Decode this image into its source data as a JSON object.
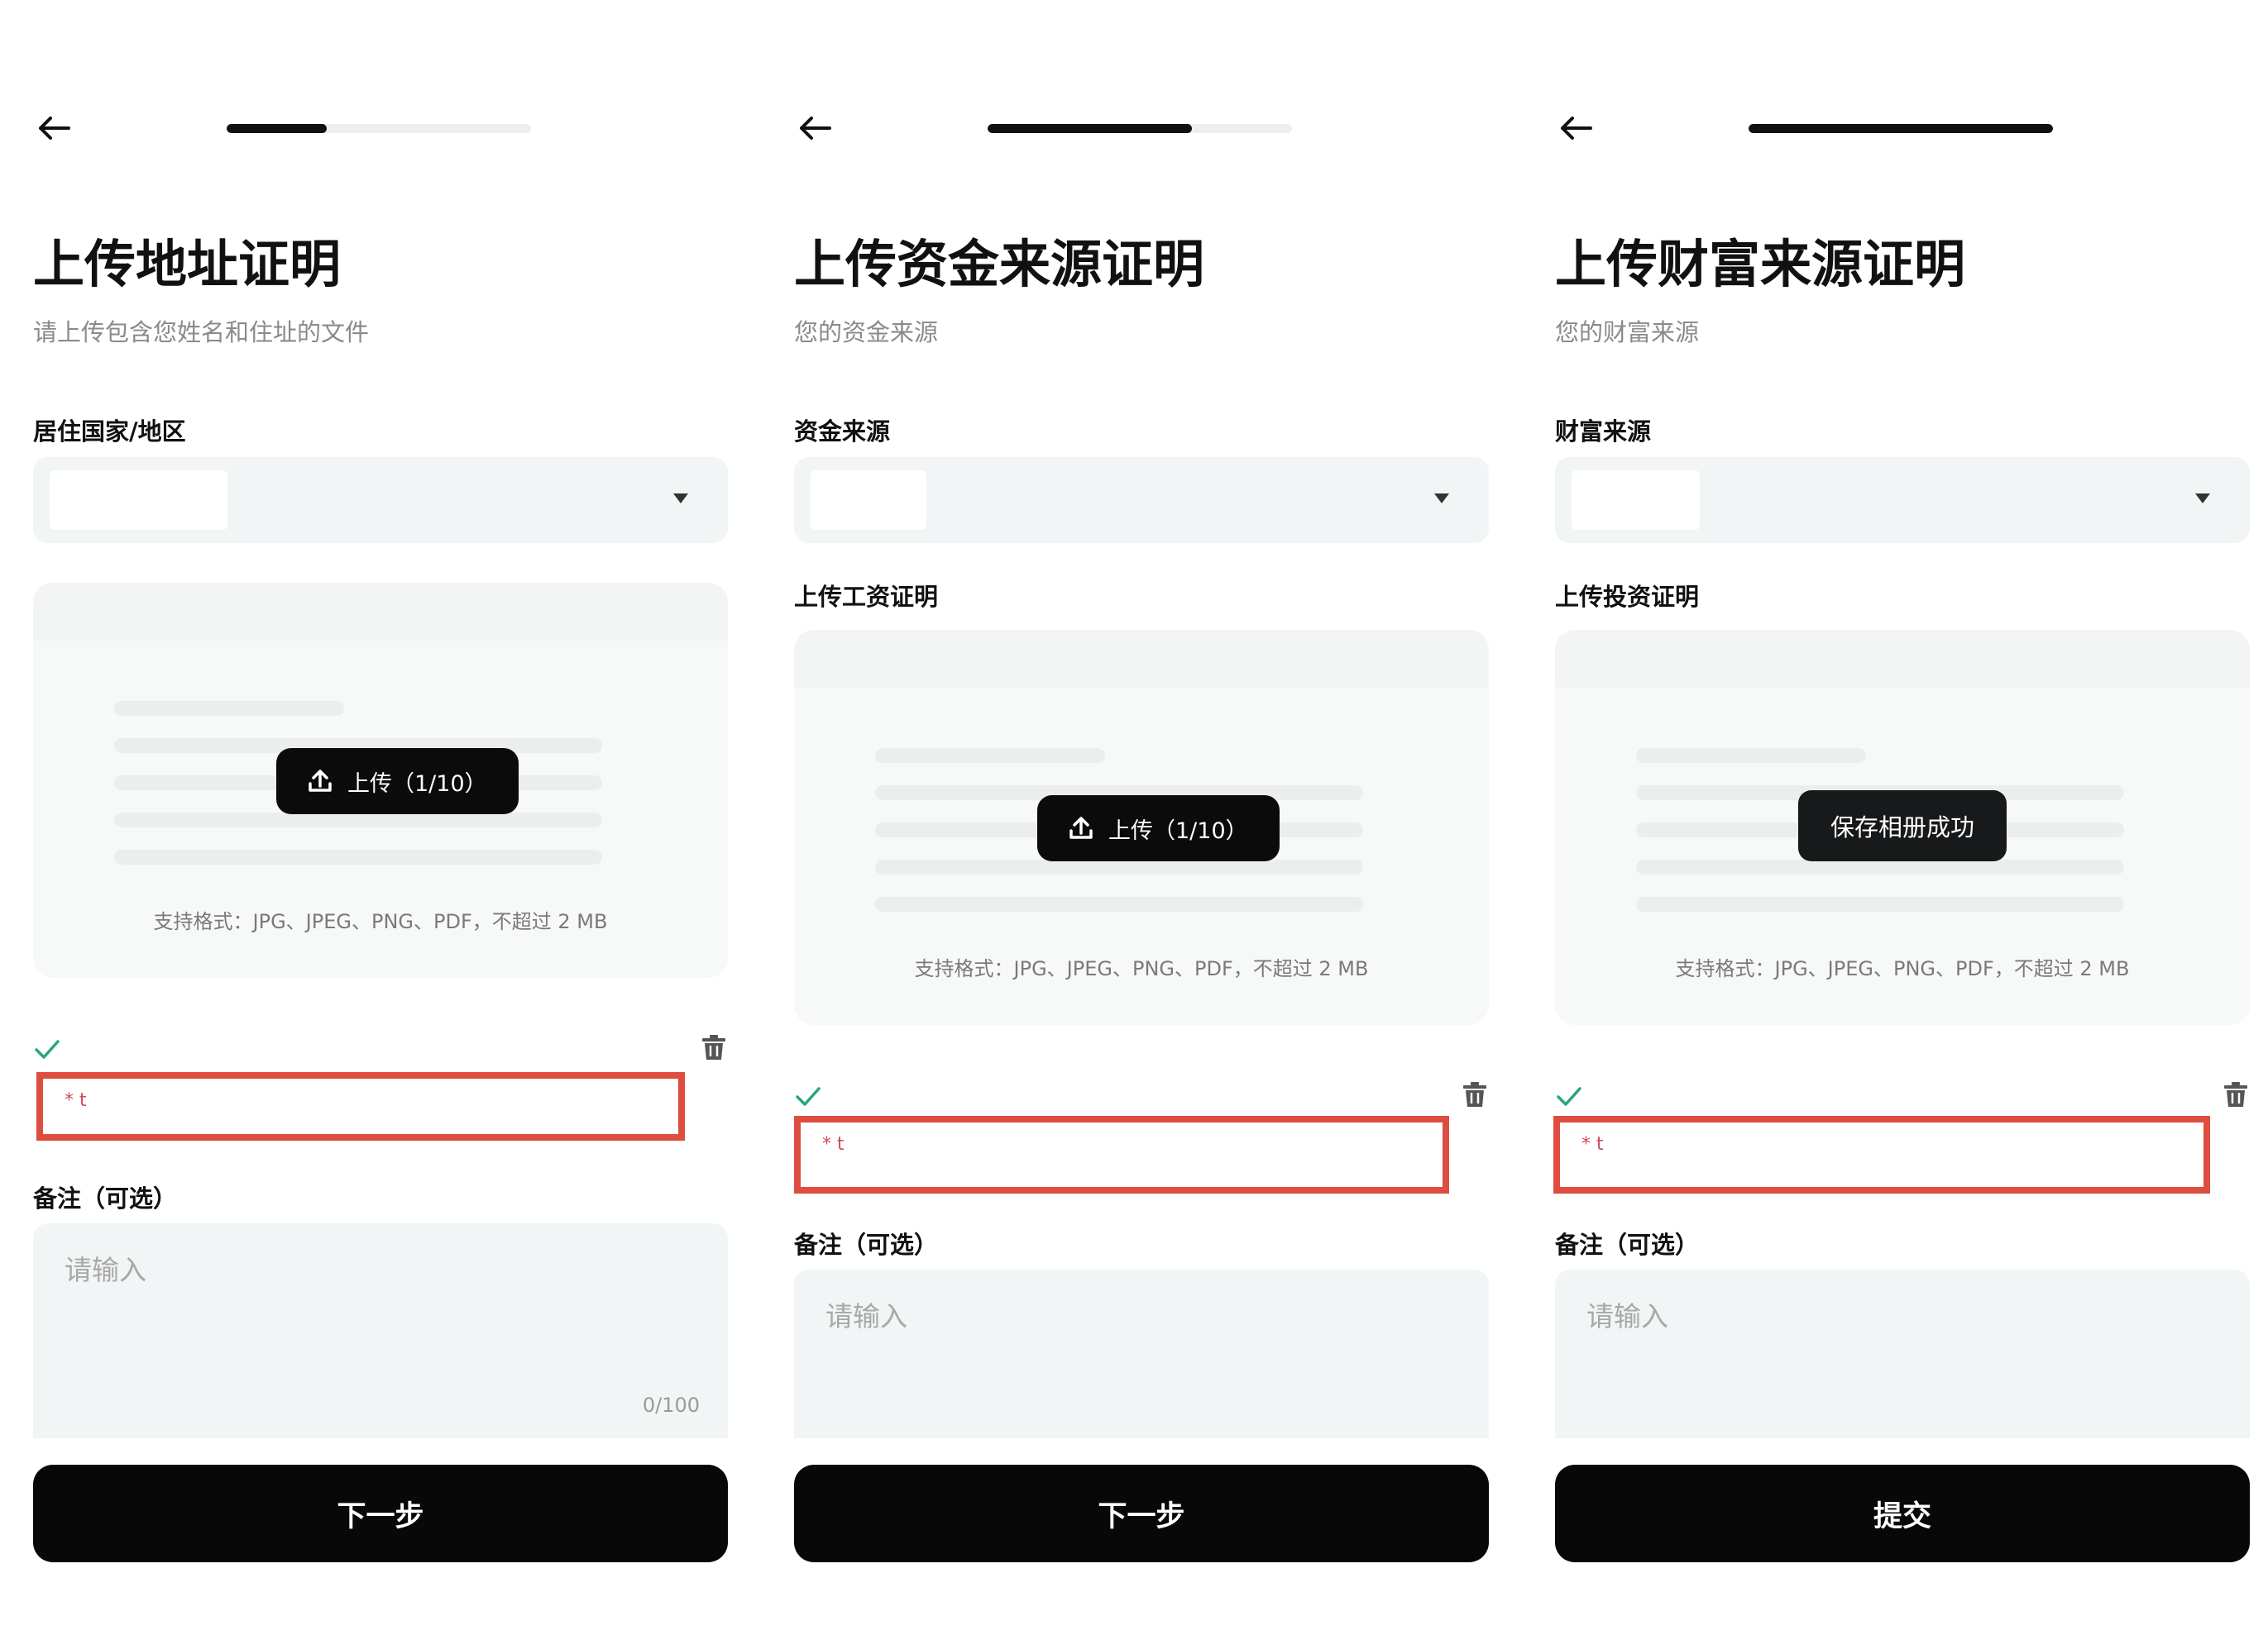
{
  "colors": {
    "accent": "#111111",
    "highlight_border": "#dd4d40",
    "check": "#2aa676",
    "input_bg": "#f2f5f5"
  },
  "screens": [
    {
      "progress": 0.33,
      "title": "上传地址证明",
      "subtitle": "请上传包含您姓名和住址的文件",
      "select_label": "居住国家/地区",
      "upload_label": "",
      "upload_button": "上传（1/10）",
      "upload_hint": "支持格式：JPG、JPEG、PNG、PDF，不超过 2 MB",
      "file_name": "* t",
      "notes_label": "备注（可选）",
      "notes_placeholder": "请输入",
      "notes_count": "0/100",
      "primary_button": "下一步"
    },
    {
      "progress": 0.67,
      "title": "上传资金来源证明",
      "subtitle": "您的资金来源",
      "select_label": "资金来源",
      "upload_label": "上传工资证明",
      "upload_button": "上传（1/10）",
      "upload_hint": "支持格式：JPG、JPEG、PNG、PDF，不超过 2 MB",
      "file_name": "* t",
      "notes_label": "备注（可选）",
      "notes_placeholder": "请输入",
      "notes_count": "",
      "primary_button": "下一步"
    },
    {
      "progress": 1.0,
      "title": "上传财富来源证明",
      "subtitle": "您的财富来源",
      "select_label": "财富来源",
      "upload_label": "上传投资证明",
      "toast": "保存相册成功",
      "upload_hint": "支持格式：JPG、JPEG、PNG、PDF，不超过 2 MB",
      "file_name": "* t",
      "notes_label": "备注（可选）",
      "notes_placeholder": "请输入",
      "notes_count": "",
      "primary_button": "提交"
    }
  ]
}
